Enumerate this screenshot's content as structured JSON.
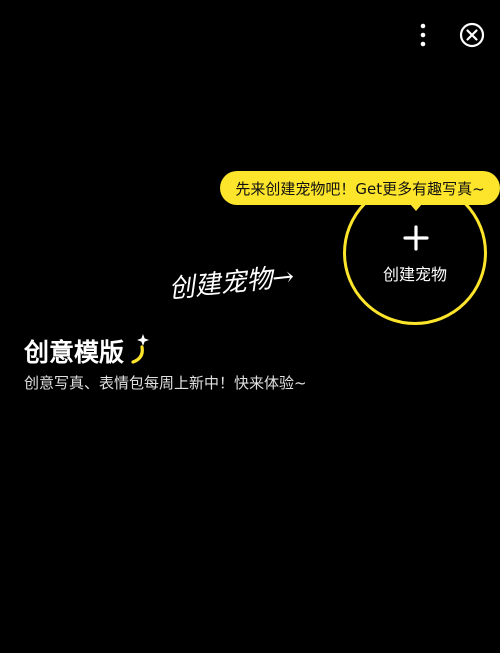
{
  "header": {
    "more_icon": "more-vertical-icon",
    "close_icon": "close-circle-icon"
  },
  "tooltip": {
    "text": "先来创建宠物吧！Get更多有趣写真~"
  },
  "create_pet": {
    "icon": "plus-icon",
    "label": "创建宠物"
  },
  "hint": {
    "text": "创建宠物→"
  },
  "section": {
    "title": "创意模版",
    "sparkle_icon": "sparkle-icon",
    "subtitle": "创意写真、表情包每周上新中！快来体验~"
  },
  "colors": {
    "background": "#000000",
    "accent": "#fde52b",
    "text": "#ffffff"
  }
}
